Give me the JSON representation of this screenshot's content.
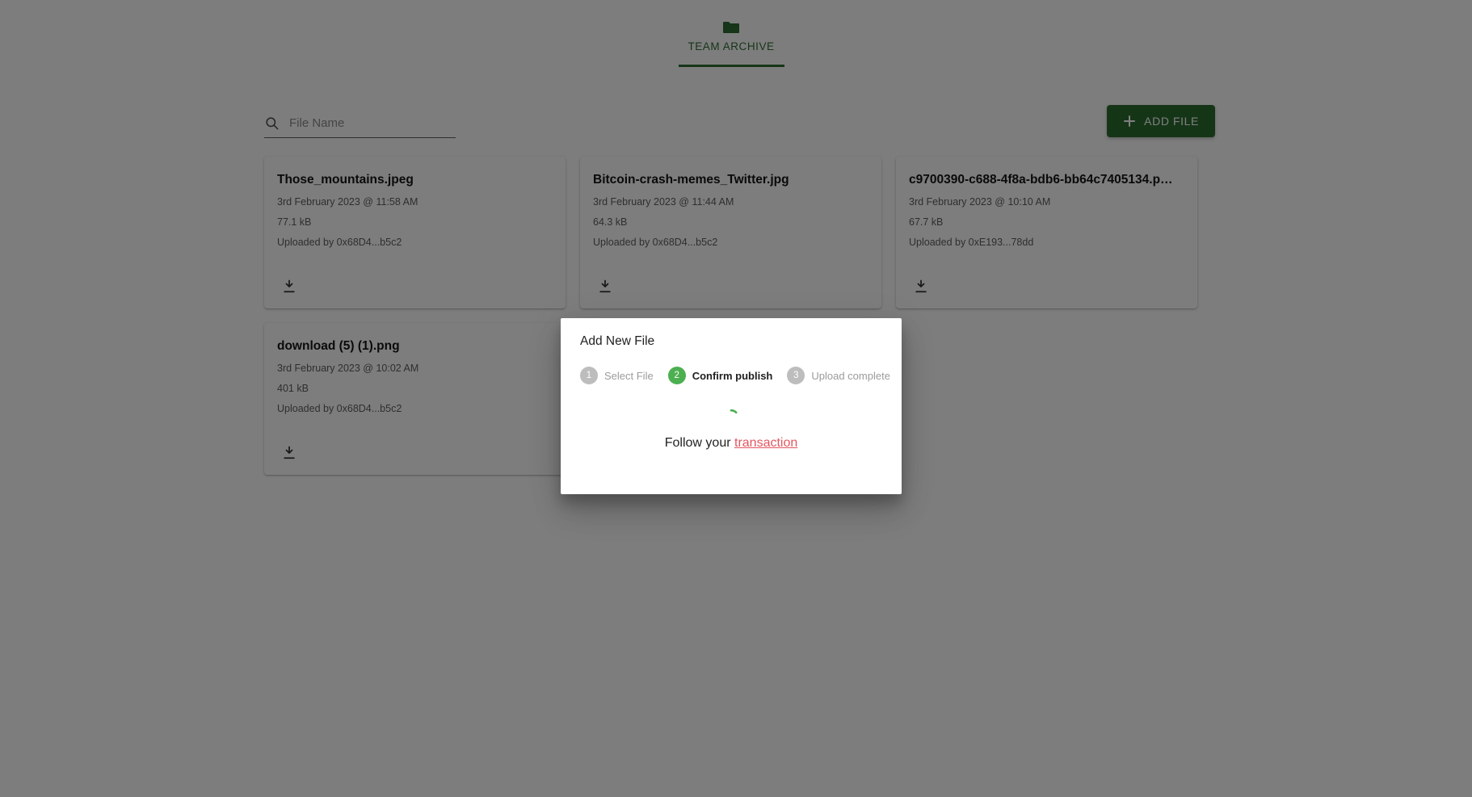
{
  "tab": {
    "label": "TEAM ARCHIVE",
    "icon": "folder-icon",
    "accent_color": "#2e6b33",
    "active": true
  },
  "toolbar": {
    "search": {
      "placeholder": "File Name",
      "value": "",
      "icon": "search-icon"
    },
    "add_file": {
      "label": "ADD FILE",
      "icon": "plus-icon",
      "color": "#2b6b2f"
    }
  },
  "files": [
    {
      "name": "Those_mountains.jpeg",
      "date": "3rd February 2023 @ 11:58 AM",
      "size": "77.1 kB",
      "uploader": "Uploaded by 0x68D4...b5c2",
      "download_icon": "download-icon"
    },
    {
      "name": "Bitcoin-crash-memes_Twitter.jpg",
      "date": "3rd February 2023 @ 11:44 AM",
      "size": "64.3 kB",
      "uploader": "Uploaded by 0x68D4...b5c2",
      "download_icon": "download-icon"
    },
    {
      "name": "c9700390-c688-4f8a-bdb6-bb64c7405134.p…",
      "date": "3rd February 2023 @ 10:10 AM",
      "size": "67.7 kB",
      "uploader": "Uploaded by 0xE193...78dd",
      "download_icon": "download-icon"
    },
    {
      "name": "download (5) (1).png",
      "date": "3rd February 2023 @ 10:02 AM",
      "size": "401 kB",
      "uploader": "Uploaded by 0x68D4...b5c2",
      "download_icon": "download-icon"
    }
  ],
  "modal": {
    "title": "Add New File",
    "steps": [
      {
        "number": "1",
        "label": "Select File",
        "state": "inactive"
      },
      {
        "number": "2",
        "label": "Confirm publish",
        "state": "active"
      },
      {
        "number": "3",
        "label": "Upload complete",
        "state": "inactive"
      }
    ],
    "active_step_color": "#4caf50",
    "inactive_step_color": "#bdbdbd",
    "spinner": {
      "icon": "loading-spinner",
      "color": "#4caf50"
    },
    "follow_text": "Follow your",
    "link_text": "transaction",
    "link_color": "#e2565f"
  }
}
